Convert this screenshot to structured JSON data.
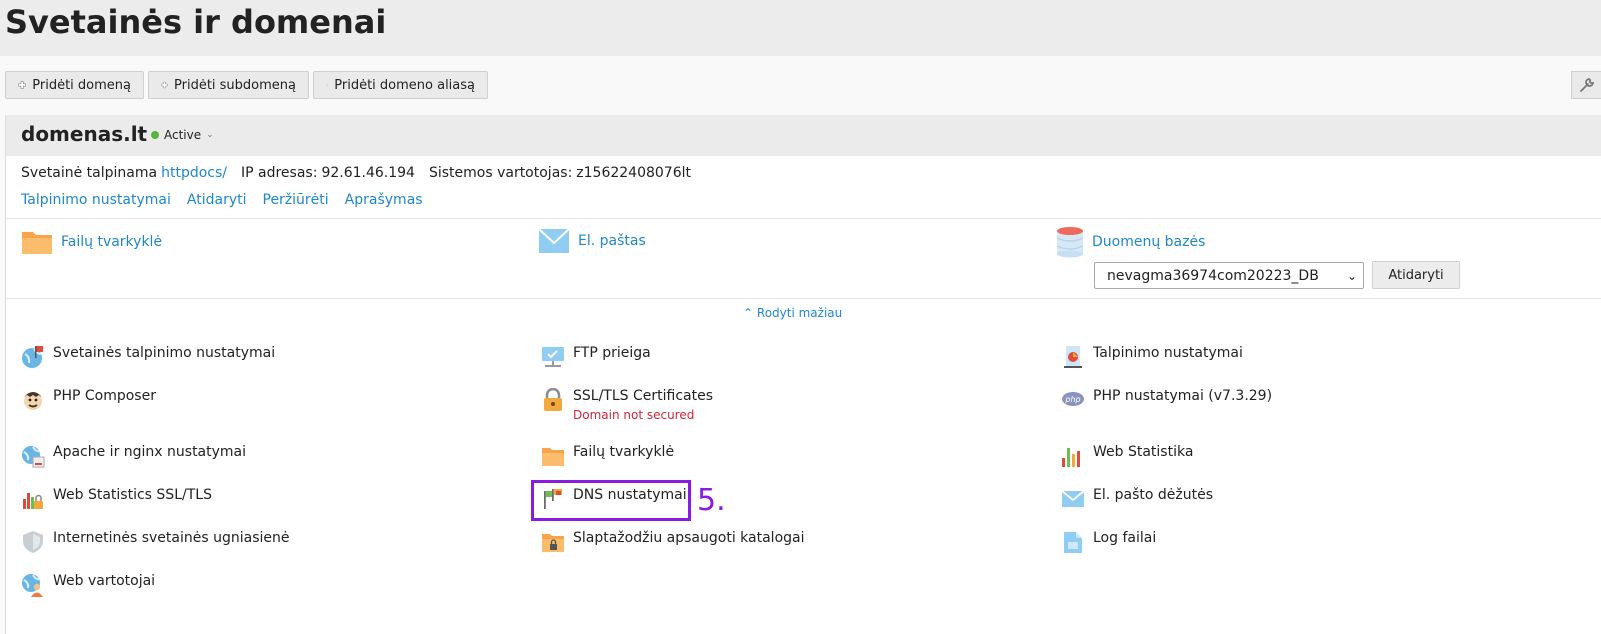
{
  "page": {
    "title": "Svetainės ir domenai"
  },
  "toolbar": {
    "add_domain": "Pridėti domeną",
    "add_subdomain": "Pridėti subdomeną",
    "add_alias": "Pridėti domeno aliasą"
  },
  "domain": {
    "name": "domenas.lt",
    "status": "Active",
    "status_color": "#59b33e",
    "hosted_label": "Svetainė talpinama",
    "hosted_path": "httpdocs/",
    "ip_label": "IP adresas:",
    "ip": "92.61.46.194",
    "user_label": "Sistemos vartotojas:",
    "user": "z15622408076lt",
    "links": [
      "Talpinimo nustatymai",
      "Atidaryti",
      "Peržiūrėti",
      "Aprašymas"
    ]
  },
  "tools": {
    "file_manager": "Failų tvarkyklė",
    "mail": "El. paštas",
    "databases": "Duomenų bazės",
    "db_selected": "nevagma36974com20223_DB",
    "db_open": "Atidaryti",
    "show_less": "Rodyti mažiau"
  },
  "services": {
    "hosting_settings": "Svetainės talpinimo nustatymai",
    "ftp": "FTP prieiga",
    "hosting_params": "Talpinimo nustatymai",
    "php_composer": "PHP Composer",
    "ssl": "SSL/TLS Certificates",
    "ssl_status": "Domain not secured",
    "php_settings": "PHP nustatymai (v7.3.29)",
    "apache_nginx": "Apache ir nginx nustatymai",
    "file_manager": "Failų tvarkyklė",
    "web_stats": "Web Statistika",
    "web_stats_ssl": "Web Statistics SSL/TLS",
    "dns": "DNS nustatymai",
    "mailboxes": "El. pašto dėžutės",
    "firewall": "Internetinės svetainės ugniasienė",
    "protected_dirs": "Slaptažodžiu apsaugoti katalogai",
    "logs": "Log failai",
    "web_users": "Web vartotojai"
  },
  "annotation": {
    "step": "5.",
    "color": "#8a1be0"
  }
}
